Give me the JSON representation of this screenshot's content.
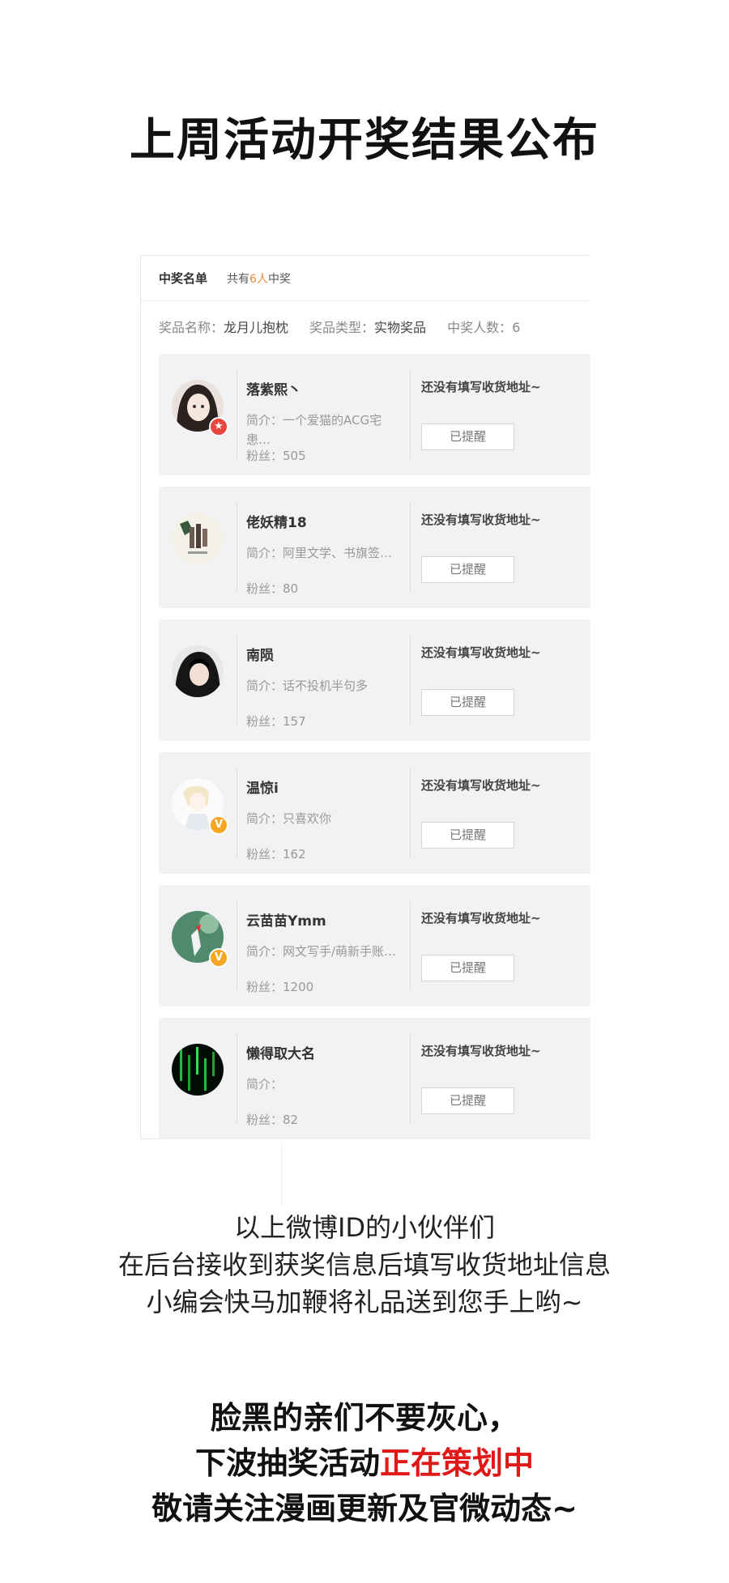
{
  "page_title": "上周活动开奖结果公布",
  "panel": {
    "title": "中奖名单",
    "count_prefix": "共有",
    "count_num": "6人",
    "count_suffix": "中奖",
    "prize_name_label": "奖品名称：",
    "prize_name": "龙月儿抱枕",
    "prize_type_label": "奖品类型：",
    "prize_type": "实物奖品",
    "winner_count_label": "中奖人数：",
    "winner_count": "6"
  },
  "winners": [
    {
      "name": "落紫熙丶",
      "intro": "简介：一个爱猫的ACG宅患…",
      "fans": "粉丝：505",
      "status": "还没有填写收货地址~",
      "button": "已提醒",
      "badge_icon": "red-star-badge",
      "badge_color": "#e8453c"
    },
    {
      "name": "佬妖精18",
      "intro": "简介：阿里文学、书旗签…",
      "fans": "粉丝：80",
      "status": "还没有填写收货地址~",
      "button": "已提醒",
      "badge_icon": "",
      "badge_color": ""
    },
    {
      "name": "南陨",
      "intro": "简介：话不投机半句多",
      "fans": "粉丝：157",
      "status": "还没有填写收货地址~",
      "button": "已提醒",
      "badge_icon": "",
      "badge_color": ""
    },
    {
      "name": "温惊i",
      "intro": "简介：只喜欢你",
      "fans": "粉丝：162",
      "status": "还没有填写收货地址~",
      "button": "已提醒",
      "badge_icon": "vip-badge",
      "badge_color": "#f5a623"
    },
    {
      "name": "云苗苗Ymm",
      "intro": "简介：网文写手/萌新手账…",
      "fans": "粉丝：1200",
      "status": "还没有填写收货地址~",
      "button": "已提醒",
      "badge_icon": "verified-v-badge",
      "badge_color": "#f5a623"
    },
    {
      "name": "懒得取大名",
      "intro": "简介：",
      "fans": "粉丝：82",
      "status": "还没有填写收货地址~",
      "button": "已提醒",
      "badge_icon": "",
      "badge_color": ""
    }
  ],
  "note_lines": [
    "以上微博ID的小伙伴们",
    "在后台接收到获奖信息后填写收货地址信息",
    "小编会快马加鞭将礼品送到您手上哟~"
  ],
  "closing": {
    "line1": "脸黑的亲们不要灰心，",
    "line2_prefix": "下波抽奖活动",
    "line2_highlight": "正在策划中",
    "line3": "敬请关注漫画更新及官微动态~"
  },
  "colors": {
    "highlight_red": "#e01818",
    "count_orange": "#f08a3c",
    "card_bg": "#f2f2f4"
  }
}
